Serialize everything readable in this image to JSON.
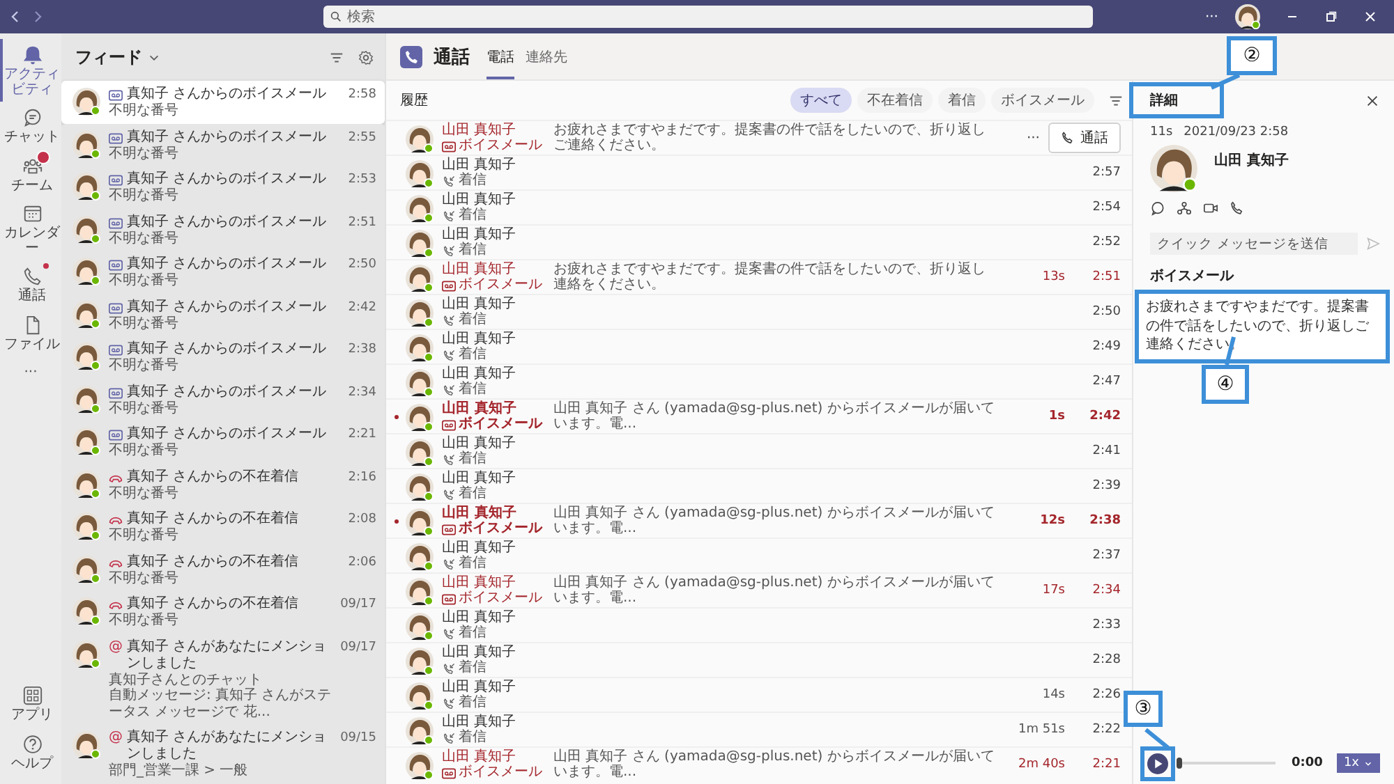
{
  "title_bar": {
    "search_placeholder": "検索",
    "more": "···"
  },
  "app_rail": {
    "items": [
      {
        "label": "アクティビティ",
        "selected": true,
        "badge": false,
        "dot": false
      },
      {
        "label": "チャット",
        "selected": false,
        "badge": false,
        "dot": false
      },
      {
        "label": "チーム",
        "selected": false,
        "badge": true,
        "dot": false
      },
      {
        "label": "カレンダー",
        "selected": false,
        "badge": false,
        "dot": false
      },
      {
        "label": "通話",
        "selected": false,
        "badge": false,
        "dot": true
      },
      {
        "label": "ファイル",
        "selected": false,
        "badge": false,
        "dot": false
      }
    ],
    "more": "···",
    "bottom_items": [
      {
        "label": "アプリ"
      },
      {
        "label": "ヘルプ"
      }
    ]
  },
  "feed": {
    "title": "フィード",
    "items": [
      {
        "kind": "voicemail",
        "title": "真知子 さんからのボイスメール",
        "lines": [
          "不明な番号"
        ],
        "time": "2:58",
        "selected": true
      },
      {
        "kind": "voicemail",
        "title": "真知子 さんからのボイスメール",
        "lines": [
          "不明な番号"
        ],
        "time": "2:55",
        "selected": false
      },
      {
        "kind": "voicemail",
        "title": "真知子 さんからのボイスメール",
        "lines": [
          "不明な番号"
        ],
        "time": "2:53",
        "selected": false
      },
      {
        "kind": "voicemail",
        "title": "真知子 さんからのボイスメール",
        "lines": [
          "不明な番号"
        ],
        "time": "2:51",
        "selected": false
      },
      {
        "kind": "voicemail",
        "title": "真知子 さんからのボイスメール",
        "lines": [
          "不明な番号"
        ],
        "time": "2:50",
        "selected": false
      },
      {
        "kind": "voicemail",
        "title": "真知子 さんからのボイスメール",
        "lines": [
          "不明な番号"
        ],
        "time": "2:42",
        "selected": false
      },
      {
        "kind": "voicemail",
        "title": "真知子 さんからのボイスメール",
        "lines": [
          "不明な番号"
        ],
        "time": "2:38",
        "selected": false
      },
      {
        "kind": "voicemail",
        "title": "真知子 さんからのボイスメール",
        "lines": [
          "不明な番号"
        ],
        "time": "2:34",
        "selected": false
      },
      {
        "kind": "voicemail",
        "title": "真知子 さんからのボイスメール",
        "lines": [
          "不明な番号"
        ],
        "time": "2:21",
        "selected": false
      },
      {
        "kind": "missed",
        "title": "真知子 さんからの不在着信",
        "lines": [
          "不明な番号"
        ],
        "time": "2:16",
        "selected": false
      },
      {
        "kind": "missed",
        "title": "真知子 さんからの不在着信",
        "lines": [
          "不明な番号"
        ],
        "time": "2:08",
        "selected": false
      },
      {
        "kind": "missed",
        "title": "真知子 さんからの不在着信",
        "lines": [
          "不明な番号"
        ],
        "time": "2:06",
        "selected": false
      },
      {
        "kind": "missed",
        "title": "真知子 さんからの不在着信",
        "lines": [
          "不明な番号"
        ],
        "time": "09/17",
        "selected": false
      },
      {
        "kind": "mention",
        "symbol": "@",
        "title": "真知子 さんがあなたにメンションしました",
        "lines": [
          "真知子さんとのチャット",
          "自動メッセージ: 真知子 さんがステータス メッセージで 花..."
        ],
        "time": "09/17",
        "selected": false
      },
      {
        "kind": "mention",
        "symbol": "@",
        "title": "真知子 さんがあなたにメンションしました",
        "lines": [
          "部門_営業一課 > 一般"
        ],
        "time": "09/15",
        "selected": false
      }
    ]
  },
  "calls": {
    "title": "通話",
    "tabs": [
      {
        "label": "電話",
        "selected": true
      },
      {
        "label": "連絡先",
        "selected": false
      }
    ],
    "history_title": "履歴",
    "filters": [
      {
        "label": "すべて",
        "selected": true
      },
      {
        "label": "不在着信",
        "selected": false
      },
      {
        "label": "着信",
        "selected": false
      },
      {
        "label": "ボイスメール",
        "selected": false
      }
    ],
    "row_actions": {
      "more": "···",
      "call_button": "通話"
    },
    "rows": [
      {
        "name": "山田 真知子",
        "kind": "voicemail",
        "type_label": "ボイスメール",
        "message": "お疲れさまですやまだです。提案書の件で話をしたいので、折り返しご連絡ください。",
        "unread": false,
        "actions_shown": true
      },
      {
        "name": "山田 真知子",
        "kind": "incoming",
        "type_label": "着信",
        "time": "2:57",
        "unread": false,
        "actions_shown": false
      },
      {
        "name": "山田 真知子",
        "kind": "incoming",
        "type_label": "着信",
        "time": "2:54",
        "unread": false,
        "actions_shown": false
      },
      {
        "name": "山田 真知子",
        "kind": "incoming",
        "type_label": "着信",
        "time": "2:52",
        "unread": false,
        "actions_shown": false
      },
      {
        "name": "山田 真知子",
        "kind": "voicemail",
        "type_label": "ボイスメール",
        "message": "お疲れさまですやまだです。提案書の件で話をしたいので、折り返し連絡をください。",
        "duration": "13s",
        "time": "2:51",
        "unread": false,
        "actions_shown": false
      },
      {
        "name": "山田 真知子",
        "kind": "incoming",
        "type_label": "着信",
        "time": "2:50",
        "unread": false,
        "actions_shown": false
      },
      {
        "name": "山田 真知子",
        "kind": "incoming",
        "type_label": "着信",
        "time": "2:49",
        "unread": false,
        "actions_shown": false
      },
      {
        "name": "山田 真知子",
        "kind": "incoming",
        "type_label": "着信",
        "time": "2:47",
        "unread": false,
        "actions_shown": false
      },
      {
        "name": "山田 真知子",
        "kind": "voicemail",
        "type_label": "ボイスメール",
        "message": "山田 真知子 さん (yamada@sg-plus.net) からボイスメールが届いています。電...",
        "duration": "1s",
        "time": "2:42",
        "unread": true,
        "actions_shown": false
      },
      {
        "name": "山田 真知子",
        "kind": "incoming",
        "type_label": "着信",
        "time": "2:41",
        "unread": false,
        "actions_shown": false
      },
      {
        "name": "山田 真知子",
        "kind": "incoming",
        "type_label": "着信",
        "time": "2:39",
        "unread": false,
        "actions_shown": false
      },
      {
        "name": "山田 真知子",
        "kind": "voicemail",
        "type_label": "ボイスメール",
        "message": "山田 真知子 さん (yamada@sg-plus.net) からボイスメールが届いています。電...",
        "duration": "12s",
        "time": "2:38",
        "unread": true,
        "actions_shown": false
      },
      {
        "name": "山田 真知子",
        "kind": "incoming",
        "type_label": "着信",
        "time": "2:37",
        "unread": false,
        "actions_shown": false
      },
      {
        "name": "山田 真知子",
        "kind": "voicemail",
        "type_label": "ボイスメール",
        "message": "山田 真知子 さん (yamada@sg-plus.net) からボイスメールが届いています。電...",
        "duration": "17s",
        "time": "2:34",
        "unread": false,
        "actions_shown": false
      },
      {
        "name": "山田 真知子",
        "kind": "incoming",
        "type_label": "着信",
        "time": "2:33",
        "unread": false,
        "actions_shown": false
      },
      {
        "name": "山田 真知子",
        "kind": "incoming",
        "type_label": "着信",
        "time": "2:28",
        "unread": false,
        "actions_shown": false
      },
      {
        "name": "山田 真知子",
        "kind": "incoming",
        "type_label": "着信",
        "duration": "14s",
        "time": "2:26",
        "unread": false,
        "actions_shown": false
      },
      {
        "name": "山田 真知子",
        "kind": "incoming",
        "type_label": "着信",
        "duration": "1m 51s",
        "time": "2:22",
        "unread": false,
        "actions_shown": false
      },
      {
        "name": "山田 真知子",
        "kind": "voicemail",
        "type_label": "ボイスメール",
        "message": "山田 真知子 さん (yamada@sg-plus.net) からボイスメールが届いています。電...",
        "duration": "2m 40s",
        "time": "2:21",
        "unread": false,
        "actions_shown": false
      }
    ]
  },
  "details": {
    "tab": {
      "label": "詳細",
      "highlighted": true
    },
    "duration": "11s",
    "datetime": "2021/09/23 2:58",
    "name": "山田 真知子",
    "quick_message_placeholder": "クイック メッセージを送信",
    "voicemail_title": "ボイスメール",
    "transcript": {
      "text": "お疲れさまですやまだです。提案書の件で話をしたいので、折り返しご連絡ください。",
      "highlighted": true
    },
    "player": {
      "level": 0,
      "time": "0:00",
      "speed": "1x",
      "highlighted": true
    }
  },
  "callouts": [
    {
      "label": "②"
    },
    {
      "label": "④"
    },
    {
      "label": "③"
    }
  ]
}
